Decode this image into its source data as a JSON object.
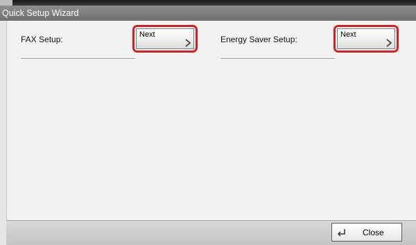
{
  "window": {
    "title": "Quick Setup Wizard"
  },
  "rows": [
    {
      "label": "FAX Setup:",
      "button_label": "Next"
    },
    {
      "label": "Energy Saver Setup:",
      "button_label": "Next"
    }
  ],
  "footer": {
    "close_label": "Close"
  },
  "colors": {
    "highlight": "#e0191b",
    "titlebar": "#7e7e7e",
    "panel": "#f2f2f2"
  }
}
